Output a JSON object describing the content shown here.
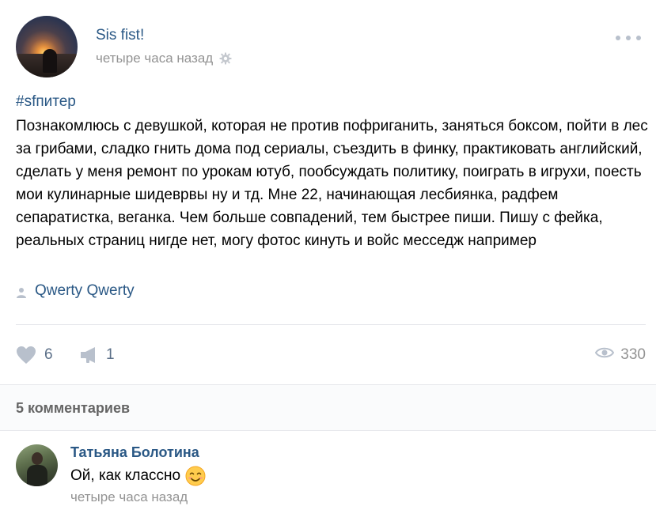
{
  "post": {
    "author": "Sis fist!",
    "time": "четыре часа назад",
    "hashtag": "#sfпитер",
    "text": "Познакомлюсь с девушкой, которая не против пофриганить, заняться боксом, пойти в лес за грибами, сладко гнить дома под сериалы, съездить в финку, практиковать английский, сделать у меня ремонт по урокам ютуб, пообсуждать политику, поиграть в игрухи, поесть мои кулинарные шидеврвы ну и тд. Мне 22, начинающая лесбиянка, радфем сепаратистка, веганка. Чем больше совпадений, тем быстрее пиши. Пишу с фейка, реальных страниц нигде нет, могу фотос кинуть и войс месседж например",
    "signer": "Qwerty Qwerty"
  },
  "actions": {
    "likes": "6",
    "shares": "1",
    "views": "330"
  },
  "comments": {
    "count_label": "5 комментариев",
    "items": [
      {
        "author": "Татьяна Болотина",
        "text": "Ой, как классно",
        "time": "четыре часа назад"
      }
    ]
  },
  "icons": {
    "gear": "gear-icon",
    "more": "more-dots-icon",
    "person": "person-icon",
    "like": "heart-icon",
    "share": "megaphone-icon",
    "views": "eye-icon",
    "emoji": "smiling-face-emoji"
  },
  "colors": {
    "link": "#2a5885",
    "muted": "#939393",
    "action": "#5b6f88",
    "icon": "#b8c0cc"
  }
}
